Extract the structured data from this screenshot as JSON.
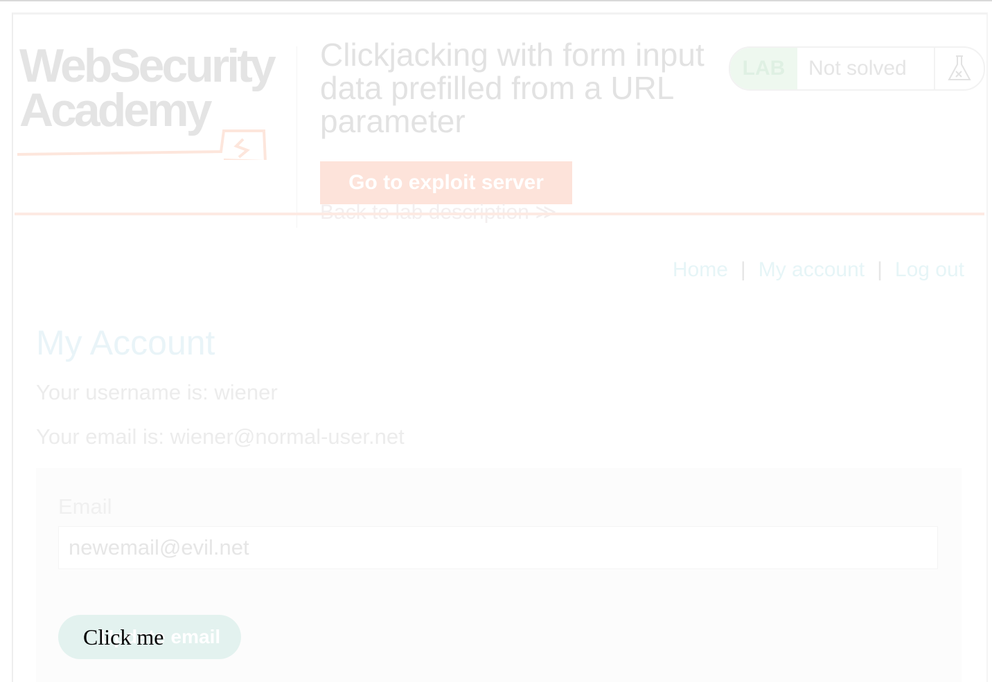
{
  "logo": {
    "line1": "WebSecurity",
    "line2": "Academy"
  },
  "lab": {
    "title": "Clickjacking with form input data prefilled from a URL parameter",
    "exploit_button": "Go to exploit server",
    "back_link": "Back to lab description",
    "back_chevrons": "≫",
    "badge": "LAB",
    "status": "Not solved",
    "status_icon": "flask-icon"
  },
  "nav": {
    "home": "Home",
    "account": "My account",
    "logout": "Log out",
    "separator": "|"
  },
  "account": {
    "title": "My Account",
    "username_line": "Your username is: wiener",
    "email_line": "Your email is: wiener@normal-user.net"
  },
  "form": {
    "email_label": "Email",
    "email_value": "newemail@evil.net",
    "update_button": "Update email"
  },
  "decoy": {
    "label": "Click me"
  },
  "colors": {
    "accent_orange": "#ff6633",
    "link_blue": "#0fb7d5",
    "lab_green": "#70d16d"
  }
}
